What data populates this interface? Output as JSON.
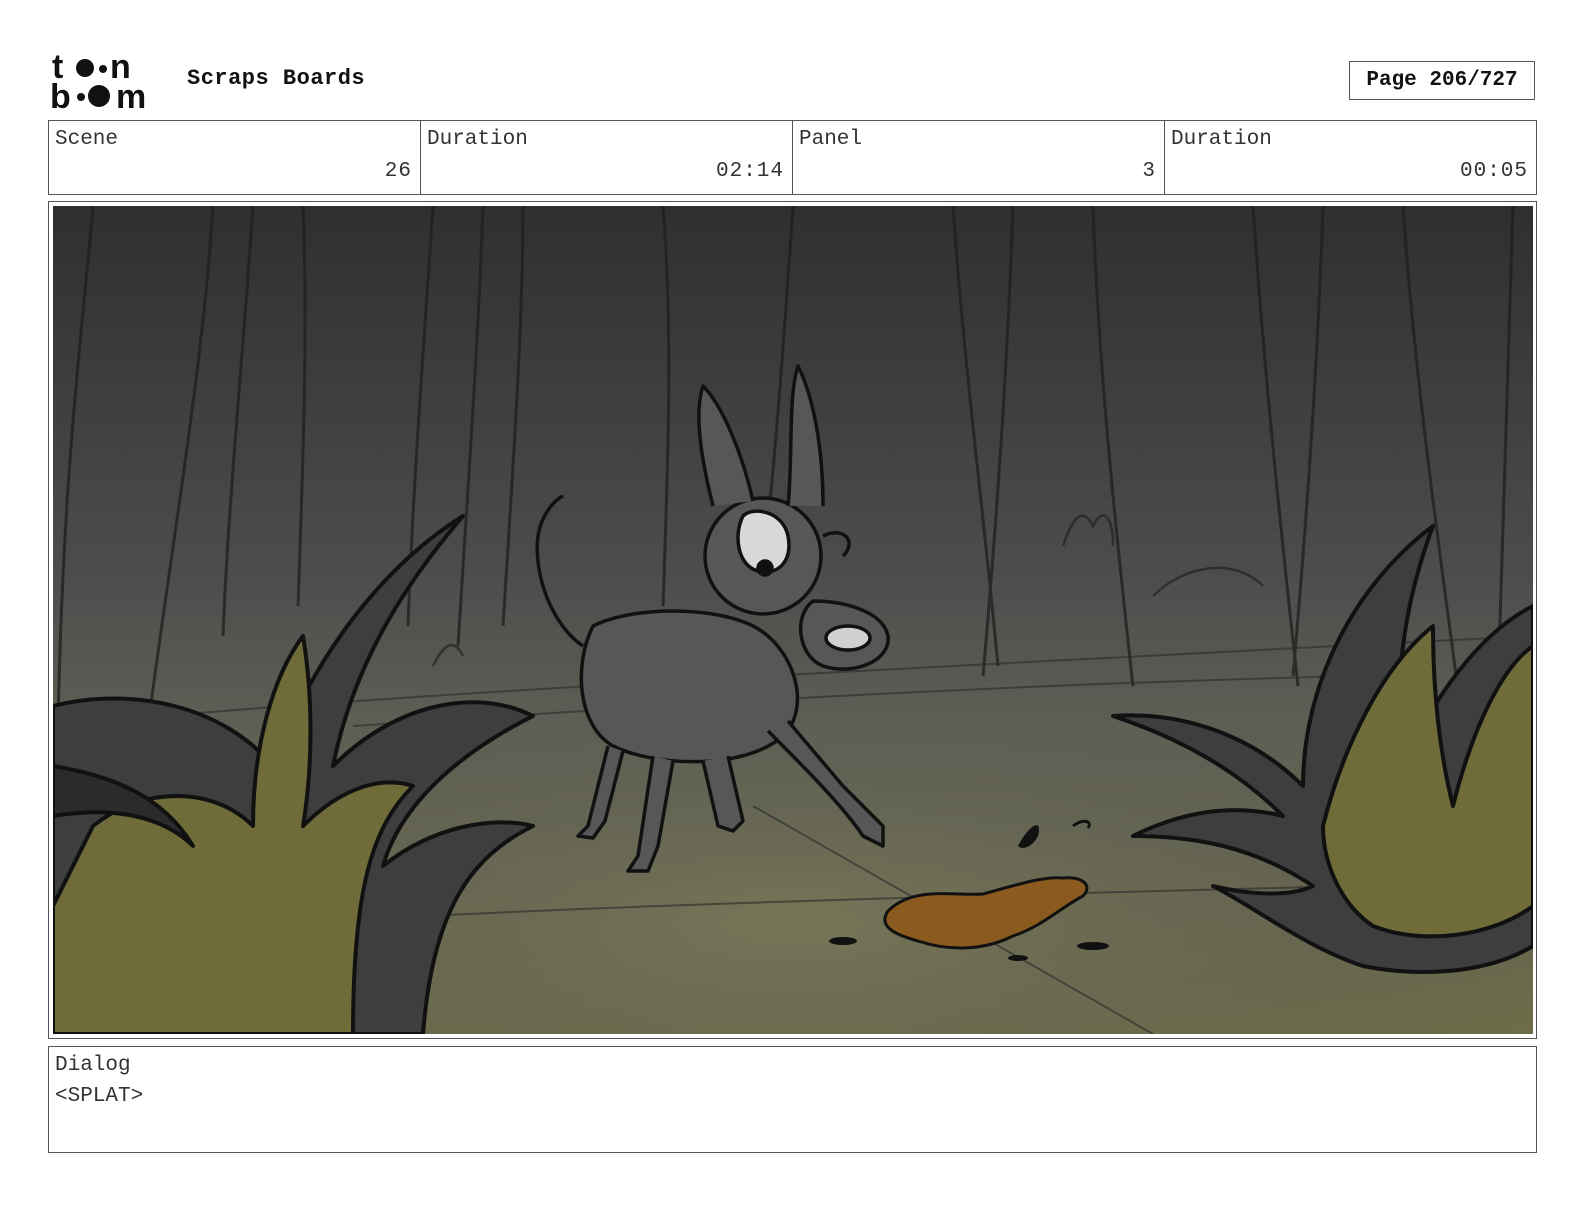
{
  "header": {
    "logo_text": "toon boom",
    "title": "Scraps Boards",
    "page_label": "Page 206/727"
  },
  "info": [
    {
      "label": "Scene",
      "value": "26"
    },
    {
      "label": "Duration",
      "value": "02:14"
    },
    {
      "label": "Panel",
      "value": "3"
    },
    {
      "label": "Duration",
      "value": "00:05"
    }
  ],
  "panel": {
    "description_icon": "storyboard-sketch-dog-forest-splat"
  },
  "dialog": {
    "label": "Dialog",
    "text": "<SPLAT>"
  },
  "colors": {
    "foliage": "#6f6c3a",
    "splat": "#8a5a1e",
    "forest_dark": "#3b3b3b"
  }
}
